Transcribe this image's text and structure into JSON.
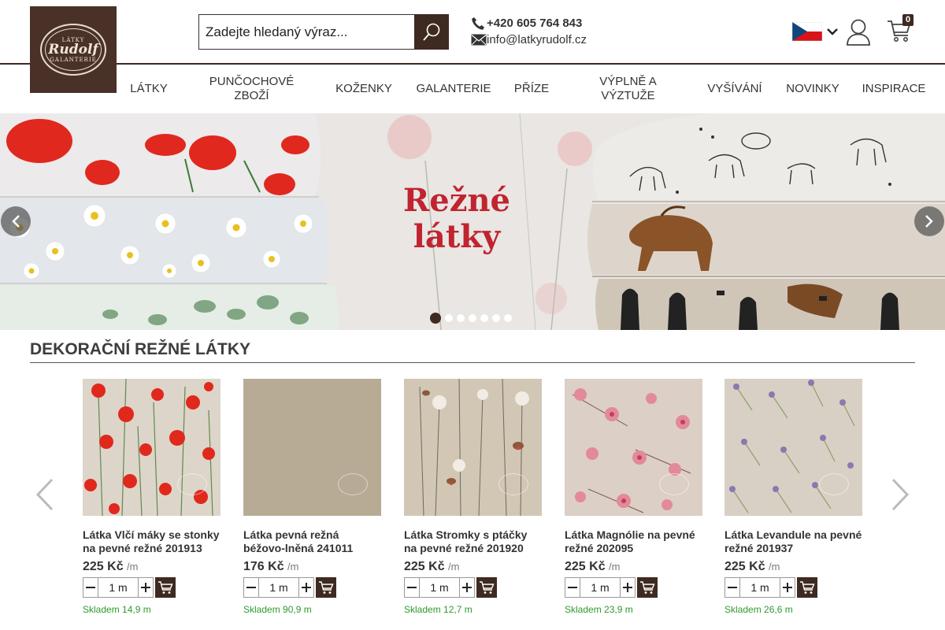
{
  "logo": {
    "top": "LÁTKY",
    "name": "Rudolf",
    "bottom": "GALANTERIE"
  },
  "search": {
    "placeholder": "Zadejte hledaný výraz..."
  },
  "contact": {
    "phone": "+420 605 764 843",
    "email": "info@latkyrudolf.cz"
  },
  "cart": {
    "count": "0"
  },
  "nav": [
    "LÁTKY",
    "PUNČOCHOVÉ ZBOŽÍ",
    "KOŽENKY",
    "GALANTERIE",
    "PŘÍZE",
    "VÝPLNĚ A VÝZTUŽE",
    "VYŠÍVÁNÍ",
    "NOVINKY",
    "INSPIRACE"
  ],
  "hero": {
    "title_line1": "Režné",
    "title_line2": "látky",
    "active_slide": 1,
    "slide_count": 7
  },
  "section": {
    "title": "DEKORAČNÍ REŽNÉ LÁTKY"
  },
  "products": [
    {
      "name": "Látka Vlčí máky se stonky na pevné režné 201913",
      "price": "225 Kč",
      "unit": "/m",
      "qty": "1 m",
      "stock": "Skladem 14,9 m"
    },
    {
      "name": "Látka pevná režná béžovo-lněná 241011",
      "price": "176 Kč",
      "unit": "/m",
      "qty": "1 m",
      "stock": "Skladem 90,9 m"
    },
    {
      "name": "Látka Stromky s ptáčky na pevné režné 201920",
      "price": "225 Kč",
      "unit": "/m",
      "qty": "1 m",
      "stock": "Skladem 12,7 m"
    },
    {
      "name": "Látka Magnólie na pevné režné 202095",
      "price": "225 Kč",
      "unit": "/m",
      "qty": "1 m",
      "stock": "Skladem 23,9 m"
    },
    {
      "name": "Látka Levandule na pevné režné 201937",
      "price": "225 Kč",
      "unit": "/m",
      "qty": "1 m",
      "stock": "Skladem 26,6 m"
    }
  ],
  "colors": {
    "brand": "#3e2a21",
    "accent_red": "#c0242f",
    "stock_green": "#2e9a2e"
  }
}
